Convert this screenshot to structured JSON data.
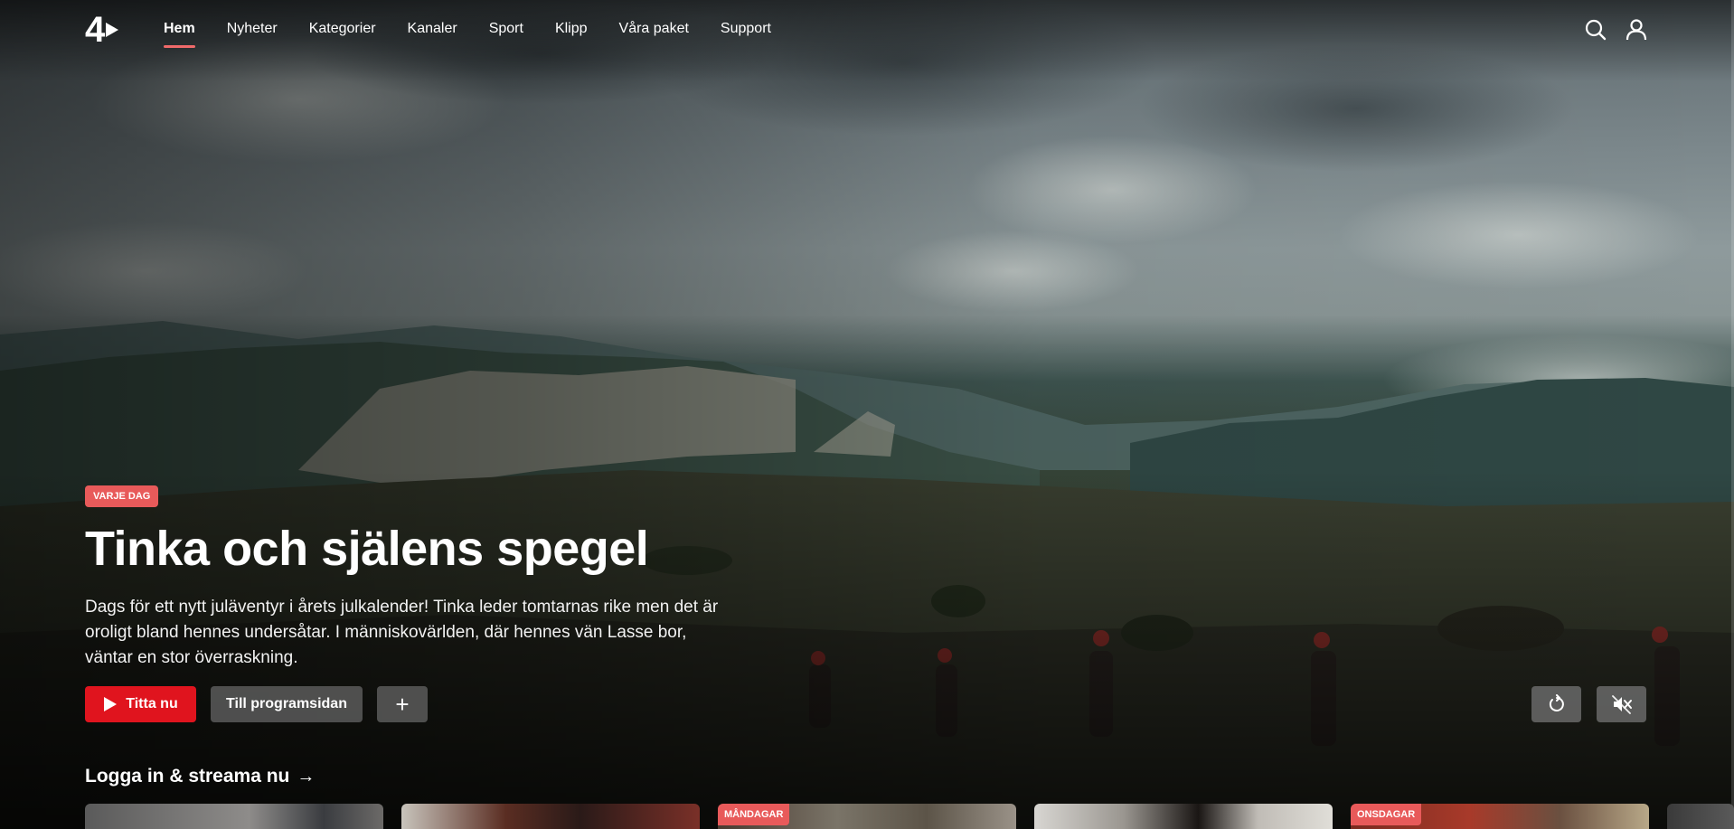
{
  "brand": {
    "logo_text": "4",
    "accent": "#e0141e",
    "badge_color": "#e85a5a"
  },
  "nav": {
    "items": [
      {
        "label": "Hem",
        "active": true
      },
      {
        "label": "Nyheter"
      },
      {
        "label": "Kategorier"
      },
      {
        "label": "Kanaler"
      },
      {
        "label": "Sport"
      },
      {
        "label": "Klipp"
      },
      {
        "label": "Våra paket"
      },
      {
        "label": "Support"
      }
    ],
    "icons": [
      "search-icon",
      "user-icon"
    ]
  },
  "hero": {
    "badge": "VARJE DAG",
    "title": "Tinka och själens spegel",
    "description": "Dags för ett nytt juläventyr i årets julkalender! Tinka leder tomtarnas rike men det är oroligt bland hennes undersåtar. I människovärlden, där hennes vän Lasse bor, väntar en stor överraskning.",
    "play_label": "Titta nu",
    "program_label": "Till programsidan",
    "add_label": "+",
    "controls": [
      "replay-icon",
      "mute-icon"
    ]
  },
  "row": {
    "title": "Logga in & streama nu",
    "arrow": "→",
    "cards": [
      {
        "badge": ""
      },
      {
        "badge": ""
      },
      {
        "badge": "MÅNDAGAR"
      },
      {
        "badge": ""
      },
      {
        "badge": "ONSDAGAR"
      },
      {
        "badge": ""
      }
    ]
  }
}
